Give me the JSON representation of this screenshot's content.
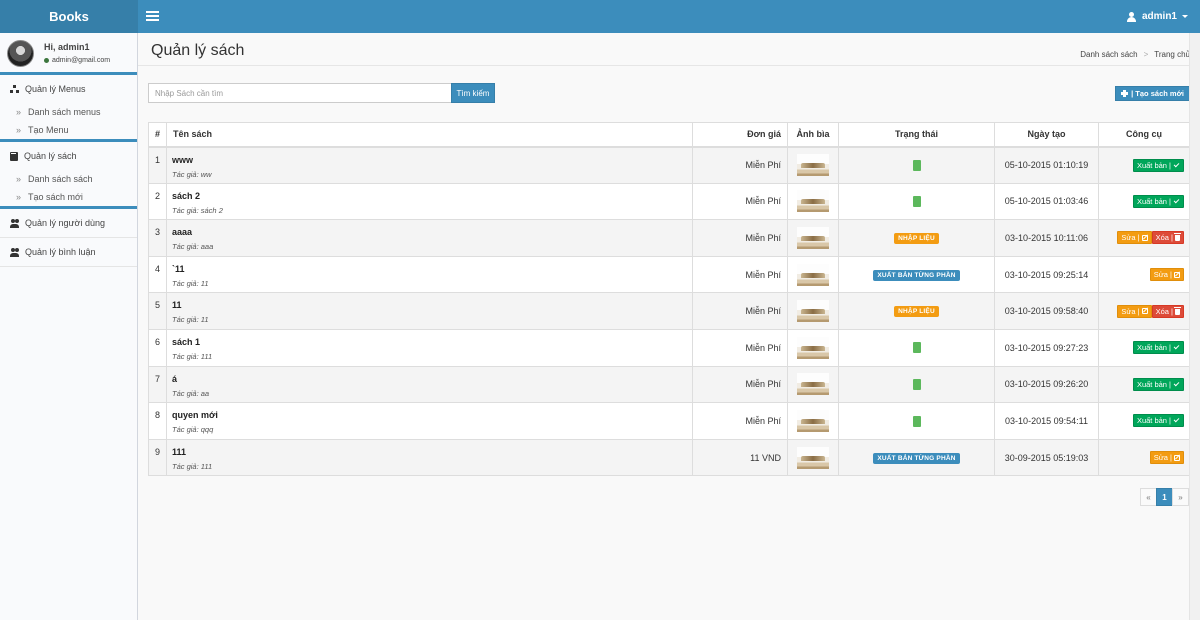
{
  "app": {
    "brand": "Books"
  },
  "topbar": {
    "user_label": "admin1"
  },
  "sidebar": {
    "greeting": "Hi, admin1",
    "email": "admin@gmail.com",
    "groups": [
      {
        "label": "Quản lý Menus",
        "icon": "sitemap-icon",
        "items": [
          "Danh sách menus",
          "Tạo Menu"
        ]
      },
      {
        "label": "Quản lý sách",
        "icon": "book-icon",
        "items": [
          "Danh sách sách",
          "Tạo sách mới"
        ]
      },
      {
        "label": "Quản lý người dùng",
        "icon": "users-icon",
        "items": []
      },
      {
        "label": "Quản lý bình luận",
        "icon": "users-icon",
        "items": []
      }
    ]
  },
  "header": {
    "title": "Quản lý sách",
    "breadcrumb": [
      "Danh sách sách",
      "Trang chủ"
    ]
  },
  "search": {
    "placeholder": "Nhập Sách cần tìm",
    "button_label": "Tìm kiếm"
  },
  "toolbar": {
    "new_label": "| Tạo sách mới"
  },
  "table": {
    "columns": [
      "#",
      "Tên sách",
      "Đơn giá",
      "Ảnh bìa",
      "Trạng thái",
      "Ngày tạo",
      "Công cụ"
    ],
    "author_prefix": "Tác giả: ",
    "rows": [
      {
        "num": "1",
        "title": "www",
        "author": "ww",
        "price": "Miễn Phí",
        "status": "published",
        "status_label": "",
        "date": "05-10-2015 01:10:19",
        "actions": [
          "publish"
        ]
      },
      {
        "num": "2",
        "title": "sách 2",
        "author": "sách 2",
        "price": "Miễn Phí",
        "status": "published",
        "status_label": "",
        "date": "05-10-2015 01:03:46",
        "actions": [
          "publish"
        ]
      },
      {
        "num": "3",
        "title": "aaaa",
        "author": "aaa",
        "price": "Miễn Phí",
        "status": "draft",
        "status_label": "NHẬP LIỆU",
        "date": "03-10-2015 10:11:06",
        "actions": [
          "edit",
          "delete"
        ]
      },
      {
        "num": "4",
        "title": "`11",
        "author": "11",
        "price": "Miễn Phí",
        "status": "partial",
        "status_label": "XUẤT BẢN TỪNG PHẦN",
        "date": "03-10-2015 09:25:14",
        "actions": [
          "edit"
        ]
      },
      {
        "num": "5",
        "title": "11",
        "author": "11",
        "price": "Miễn Phí",
        "status": "draft",
        "status_label": "NHẬP LIỆU",
        "date": "03-10-2015 09:58:40",
        "actions": [
          "edit",
          "delete"
        ]
      },
      {
        "num": "6",
        "title": "sách 1",
        "author": "111",
        "price": "Miễn Phí",
        "status": "published",
        "status_label": "",
        "date": "03-10-2015 09:27:23",
        "actions": [
          "publish"
        ]
      },
      {
        "num": "7",
        "title": "á",
        "author": "aa",
        "price": "Miễn Phí",
        "status": "published",
        "status_label": "",
        "date": "03-10-2015 09:26:20",
        "actions": [
          "publish"
        ]
      },
      {
        "num": "8",
        "title": "quyen mới",
        "author": "qqq",
        "price": "Miễn Phí",
        "status": "published",
        "status_label": "",
        "date": "03-10-2015 09:54:11",
        "actions": [
          "publish"
        ]
      },
      {
        "num": "9",
        "title": "111",
        "author": "111",
        "price": "11 VND",
        "status": "partial",
        "status_label": "XUẤT BẢN TỪNG PHẦN",
        "date": "30-09-2015 05:19:03",
        "actions": [
          "edit"
        ]
      }
    ],
    "action_labels": {
      "publish": "Xuất bản |",
      "edit": "Sửa |",
      "delete": "Xóa |"
    }
  },
  "pagination": {
    "prev": "«",
    "current": "1",
    "next": "»"
  },
  "colors": {
    "primary": "#3c8dbc",
    "success": "#00a65a",
    "warning": "#f39c12",
    "danger": "#dd4b39"
  }
}
